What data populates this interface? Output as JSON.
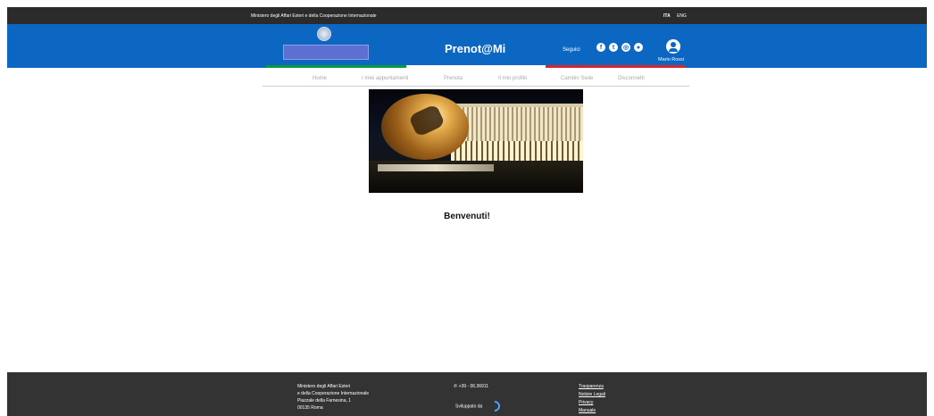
{
  "topbar": {
    "ministry": "Ministero degli Affari Esteri e della Cooperazione Internazionale",
    "languages": [
      "ITA",
      "ENG"
    ]
  },
  "header": {
    "brand": "Prenot@Mi",
    "follow_label": "Seguici",
    "social_icons": [
      "facebook-icon",
      "twitter-icon",
      "instagram-icon",
      "globe-icon"
    ],
    "user_name": "Mario Rossi",
    "accent_color": "#0b67c2"
  },
  "nav": {
    "items": [
      "Home",
      "I miei appuntamenti",
      "Prenota",
      "Il mio profilo",
      "Cambio Sede",
      "Disconnetti"
    ]
  },
  "main": {
    "welcome": "Benvenuti!"
  },
  "footer": {
    "address_lines": [
      "Ministero degli Affari Esteri",
      "e della Cooperazione Internazionale",
      "Piazzale della Farnesina, 1",
      "00135 Roma"
    ],
    "phone": "+39 - 06.36911",
    "developed_by": "Sviluppato da",
    "links": [
      "Trasparenza",
      "Notizie Legali",
      "Privacy",
      "Manuale"
    ]
  }
}
